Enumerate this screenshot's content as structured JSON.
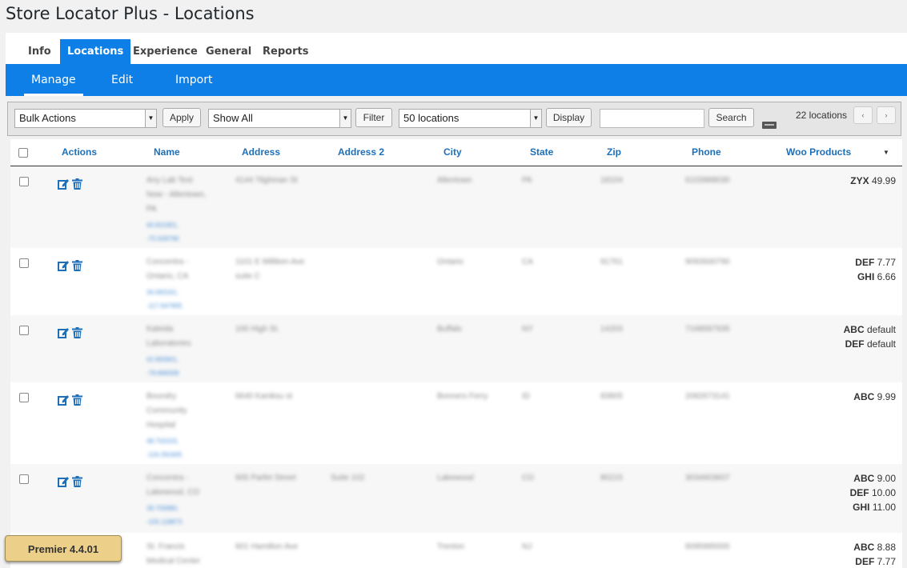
{
  "page_title": "Store Locator Plus - Locations",
  "tabs": [
    {
      "label": "Info"
    },
    {
      "label": "Locations",
      "active": true
    },
    {
      "label": "Experience"
    },
    {
      "label": "General"
    },
    {
      "label": "Reports"
    }
  ],
  "subtabs": [
    {
      "label": "Manage",
      "active": true
    },
    {
      "label": "Edit"
    },
    {
      "label": "Import"
    }
  ],
  "toolbar": {
    "bulk_actions": "Bulk Actions",
    "apply": "Apply",
    "show_filter": "Show All",
    "filter": "Filter",
    "per_page": "50 locations",
    "display": "Display",
    "search_value": "",
    "search": "Search",
    "count": "22 locations",
    "prev": "‹",
    "next": "›"
  },
  "columns": {
    "actions": "Actions",
    "name": "Name",
    "address": "Address",
    "address2": "Address 2",
    "city": "City",
    "state": "State",
    "zip": "Zip",
    "phone": "Phone",
    "woo": "Woo Products",
    "sort_indicator": "▼"
  },
  "rows": [
    {
      "name": [
        "Any Lab Test",
        "Now - Allentown,",
        "PA"
      ],
      "coords": [
        "40.601901,",
        "-75.509790"
      ],
      "address": [
        "4144 Tilghman St"
      ],
      "address2": "",
      "city": "Allentown",
      "state": "PA",
      "zip": "18104",
      "phone": "6103988030",
      "products": [
        {
          "code": "ZYX",
          "price": "49.99"
        }
      ]
    },
    {
      "name": [
        "Concentra -",
        "Ontario, CA"
      ],
      "coords": [
        "34.063161,",
        "-117.647905"
      ],
      "address": [
        "1101 E Milliken Ave",
        "suite C"
      ],
      "address2": "",
      "city": "Ontario",
      "state": "CA",
      "zip": "91761",
      "phone": "9093930790",
      "products": [
        {
          "code": "DEF",
          "price": "7.77"
        },
        {
          "code": "GHI",
          "price": "6.66"
        }
      ]
    },
    {
      "name": [
        "Kaleida",
        "Laboratories"
      ],
      "coords": [
        "42.893901,",
        "-78.868308"
      ],
      "address": [
        "100 High St."
      ],
      "address2": "",
      "city": "Buffalo",
      "state": "NY",
      "zip": "14203",
      "phone": "7168597935",
      "products": [
        {
          "code": "ABC",
          "price": "default"
        },
        {
          "code": "DEF",
          "price": "default"
        }
      ]
    },
    {
      "name": [
        "Boundry",
        "Community",
        "Hospital"
      ],
      "coords": [
        "48.703103,",
        "-116.291605"
      ],
      "address": [
        "6640 Kaniksu st"
      ],
      "address2": "",
      "city": "Bonners Ferry",
      "state": "ID",
      "zip": "83805",
      "phone": "2082673141",
      "products": [
        {
          "code": "ABC",
          "price": "9.99"
        }
      ]
    },
    {
      "name": [
        "Concentra -",
        "Lakewood, CO"
      ],
      "coords": [
        "39.705880,",
        "-105.118873"
      ],
      "address": [
        "605 Parfet Street"
      ],
      "address2": "Suite 102",
      "city": "Lakewood",
      "state": "CO",
      "zip": "80215",
      "phone": "3034603607",
      "products": [
        {
          "code": "ABC",
          "price": "9.00"
        },
        {
          "code": "DEF",
          "price": "10.00"
        },
        {
          "code": "GHI",
          "price": "11.00"
        }
      ]
    },
    {
      "name": [
        "St. Francis",
        "Medical Center"
      ],
      "coords": [],
      "address": [
        "601 Hamilton Ave"
      ],
      "address2": "",
      "city": "Trenton",
      "state": "NJ",
      "zip": "",
      "phone": "6095995000",
      "products": [
        {
          "code": "ABC",
          "price": "8.88"
        },
        {
          "code": "DEF",
          "price": "7.77"
        }
      ]
    }
  ],
  "version_badge": "Premier 4.4.01",
  "colors": {
    "accent": "#0e7fe6",
    "link": "#1e6fb7",
    "badge": "#ecd08a"
  }
}
